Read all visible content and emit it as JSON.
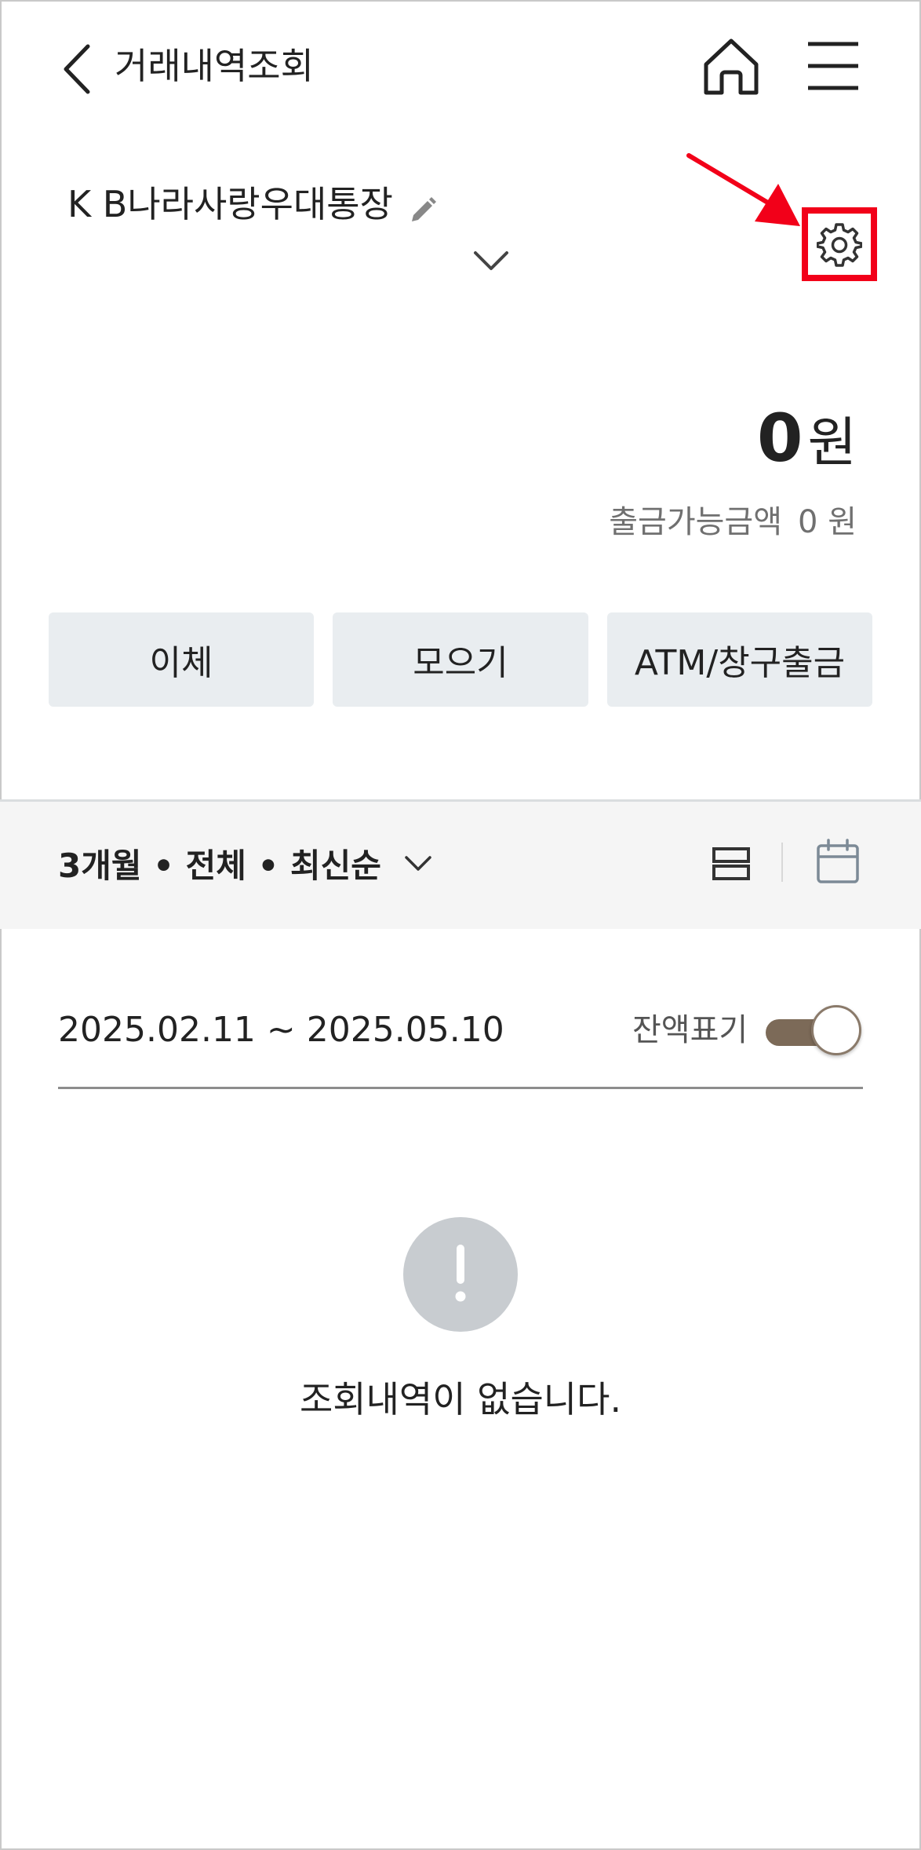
{
  "header": {
    "title": "거래내역조회",
    "back_icon": "chevron-left-icon",
    "home_icon": "home-icon",
    "menu_icon": "hamburger-menu-icon"
  },
  "account": {
    "name": "K B나라사랑우대통장",
    "edit_icon": "pencil-icon",
    "expand_icon": "chevron-down-icon",
    "settings_icon": "gear-icon",
    "highlight_color": "#f20019"
  },
  "balance": {
    "amount": "0",
    "unit": "원",
    "available_label": "출금가능금액",
    "available_amount": "0 원"
  },
  "actions": [
    {
      "label": "이체"
    },
    {
      "label": "모으기"
    },
    {
      "label": "ATM/창구출금"
    }
  ],
  "filter": {
    "summary": "3개월 • 전체 • 최신순",
    "list_icon": "list-view-icon",
    "calendar_icon": "calendar-icon"
  },
  "period": {
    "date_range": "2025.02.11 ~ 2025.05.10",
    "balance_toggle_label": "잔액표기",
    "balance_toggle_on": true,
    "toggle_color": "#7c6a58"
  },
  "empty_state": {
    "icon": "exclamation-icon",
    "message": "조회내역이 없습니다."
  }
}
